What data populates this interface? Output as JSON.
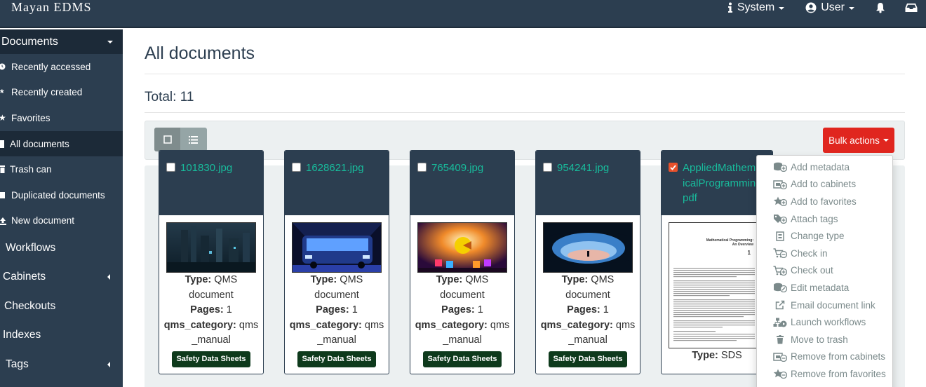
{
  "app": {
    "brand": "Mayan EDMS"
  },
  "navbar": {
    "system_label": "System",
    "user_label": "User"
  },
  "sidebar": {
    "documents_label": "Documents",
    "sub_items": [
      {
        "label": "Recently accessed",
        "icon": "clock-icon"
      },
      {
        "label": "Recently created",
        "icon": "asterisk-icon"
      },
      {
        "label": "Favorites",
        "icon": "star-icon"
      },
      {
        "label": "All documents",
        "icon": "file-icon"
      },
      {
        "label": "Trash can",
        "icon": "trash-icon"
      },
      {
        "label": "Duplicated documents",
        "icon": "copy-icon"
      },
      {
        "label": "New document",
        "icon": "upload-icon"
      }
    ],
    "top_items": [
      {
        "label": "Workflows"
      },
      {
        "label": "Cabinets"
      },
      {
        "label": "Checkouts"
      },
      {
        "label": "Indexes"
      },
      {
        "label": "Tags"
      }
    ]
  },
  "main": {
    "title": "All documents",
    "total": "Total: 11",
    "bulk_actions_label": "Bulk actions"
  },
  "documents": [
    {
      "name": "101830.jpg",
      "type_label": "Type:",
      "type_value": "QMS document",
      "pages_label": "Pages:",
      "pages_value": "1",
      "meta_label": "qms_category:",
      "meta_value": "qms _manual",
      "tag": "Safety Data Sheets",
      "checked": false
    },
    {
      "name": "1628621.jpg",
      "type_label": "Type:",
      "type_value": "QMS document",
      "pages_label": "Pages:",
      "pages_value": "1",
      "meta_label": "qms_category:",
      "meta_value": "qms _manual",
      "tag": "Safety Data Sheets",
      "checked": false
    },
    {
      "name": "765409.jpg",
      "type_label": "Type:",
      "type_value": "QMS document",
      "pages_label": "Pages:",
      "pages_value": "1",
      "meta_label": "qms_category:",
      "meta_value": "qms _manual",
      "tag": "Safety Data Sheets",
      "checked": false
    },
    {
      "name": "954241.jpg",
      "type_label": "Type:",
      "type_value": "QMS document",
      "pages_label": "Pages:",
      "pages_value": "1",
      "meta_label": "qms_category:",
      "meta_value": "qms _manual",
      "tag": "Safety Data Sheets",
      "checked": false
    },
    {
      "name": "AppliedMathematicalProgramming.pdf",
      "type_label": "Type:",
      "type_value": "SDS",
      "pdf_title": "Mathematical Programming: An Overview",
      "pdf_page": "1",
      "checked": true
    }
  ],
  "bulk_menu": [
    {
      "label": "Add metadata",
      "icon": "database-plus-icon"
    },
    {
      "label": "Add to cabinets",
      "icon": "cabinet-plus-icon"
    },
    {
      "label": "Add to favorites",
      "icon": "star-plus-icon"
    },
    {
      "label": "Attach tags",
      "icon": "tags-plus-icon"
    },
    {
      "label": "Change type",
      "icon": "file-type-icon"
    },
    {
      "label": "Check in",
      "icon": "cart-minus-icon"
    },
    {
      "label": "Check out",
      "icon": "cart-plus-icon"
    },
    {
      "label": "Edit metadata",
      "icon": "database-edit-icon"
    },
    {
      "label": "Email document link",
      "icon": "external-link-icon"
    },
    {
      "label": "Launch workflows",
      "icon": "sitemap-icon"
    },
    {
      "label": "Move to trash",
      "icon": "trash-icon"
    },
    {
      "label": "Remove from cabinets",
      "icon": "cabinet-minus-icon"
    },
    {
      "label": "Remove from favorites",
      "icon": "star-minus-icon"
    }
  ]
}
